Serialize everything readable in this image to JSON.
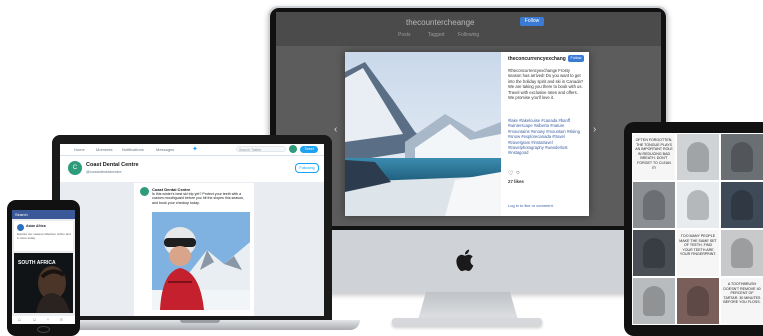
{
  "imac": {
    "profile_name": "thecountercheange",
    "follow_label": "Follow",
    "nav": [
      "Posts",
      "Tagged",
      "Following"
    ],
    "post": {
      "username": "theconcurrencyexchang",
      "follow_label": "Follow",
      "caption": "#theconcurrencyexchange Frosty season has arrived! Do you want to get into the holiday spirit and ski in Canada? We are taking you there to book with us. Travel with exclusive rates and offers. We promise you'll love it.",
      "hashtags": "#lake #lakelouise #canada #banff #winterscape #alberta #nature #mountains #snowy #mountain #skiing #snow #explorecanada #travel #travelgram #instatravel #travelphotography #wanderlust #instagood",
      "likes": "27 likes",
      "login_prompt": "Log in to like or comment."
    }
  },
  "macbook": {
    "nav": [
      "Home",
      "Moments",
      "Notifications",
      "Messages"
    ],
    "search_placeholder": "Search Twitter",
    "tweet_button": "Tweet",
    "profile_name": "Coast Dental Centre",
    "profile_handle": "@coastdentalcentre",
    "follow_label": "Following",
    "tweet": {
      "author": "Coast Dental Centre",
      "text": "Is this winter's best ski trip yet? Protect your teeth with a custom mouthguard before you hit the slopes this season, and book your checkup today."
    }
  },
  "iphone": {
    "app_bar": "Search",
    "post_author": "Asian Africa",
    "post_text": "Explore our newest collection online and in store today.",
    "photo_caption": "SOUTH AFRICA"
  },
  "ipad": {
    "tiles": [
      {
        "kind": "text",
        "text": "Often forgotten, the tongue plays an important role in reducing bad breath. Don't forget to clean it!"
      },
      {
        "kind": "image",
        "color": "#cfd3d6"
      },
      {
        "kind": "image",
        "color": "#6a6f74"
      },
      {
        "kind": "image",
        "color": "#8b8f93"
      },
      {
        "kind": "image",
        "color": "#e8ecef"
      },
      {
        "kind": "image",
        "color": "#3e4a57"
      },
      {
        "kind": "image",
        "color": "#4a4f55"
      },
      {
        "kind": "text",
        "text": "Too many people make the same set of teeth. Find your teeth are your fingerprint."
      },
      {
        "kind": "image",
        "color": "#c7c9cb"
      },
      {
        "kind": "image",
        "color": "#b9bcbe"
      },
      {
        "kind": "image",
        "color": "#7a5e5a"
      },
      {
        "kind": "text",
        "text": "A toothbrush doesn't remove 40 percent of tartar. 30 minutes before you floss."
      }
    ]
  },
  "colors": {
    "twitter_blue": "#1da1f2",
    "facebook_blue": "#3b5998",
    "instagram_blue": "#3a7bd5",
    "dental_green": "#2e9c7a"
  }
}
